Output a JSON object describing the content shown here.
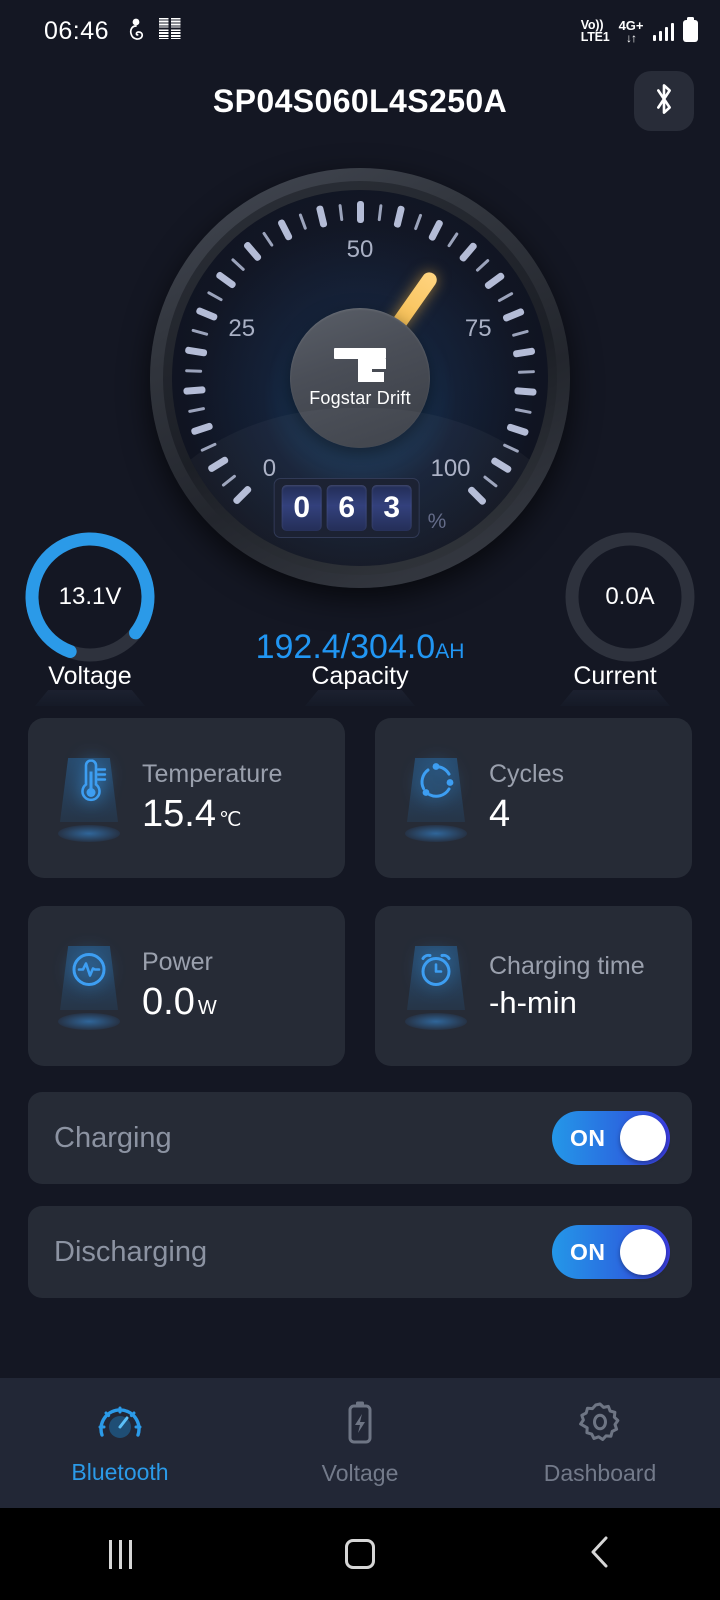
{
  "status_bar": {
    "clock": "06:46",
    "left_icons": [
      "notification-icon-1",
      "notification-icon-2"
    ],
    "volte_line1": "Vo))",
    "volte_line2": "LTE1",
    "network": "4G+",
    "data_arrows": "↓↑",
    "signal_icon": "signal-bars-icon",
    "battery_icon": "battery-full-icon"
  },
  "header": {
    "title": "SP04S060L4S250A",
    "bluetooth_icon": "bluetooth-icon"
  },
  "gauge": {
    "brand": "Fogstar Drift",
    "logo_icon": "fogstar-logo-icon",
    "tick_labels": [
      "0",
      "25",
      "50",
      "75",
      "100"
    ],
    "min": 0,
    "max": 100,
    "value": 63,
    "digits": [
      "0",
      "6",
      "3"
    ],
    "unit": "%"
  },
  "meters": {
    "voltage": {
      "value": "13.1V",
      "label": "Voltage",
      "percent": 80,
      "ring_color": "#2b9ae8"
    },
    "capacity": {
      "value": "192.4/304.0",
      "unit": "AH",
      "label": "Capacity",
      "color": "#2196f3"
    },
    "current": {
      "value": "0.0A",
      "label": "Current",
      "percent": 0,
      "ring_color": "#3a3f4c"
    }
  },
  "cards": [
    {
      "icon": "thermometer-icon",
      "title": "Temperature",
      "value": "15.4",
      "unit": "℃"
    },
    {
      "icon": "cycles-icon",
      "title": "Cycles",
      "value": "4",
      "unit": ""
    },
    {
      "icon": "power-pulse-icon",
      "title": "Power",
      "value": "0.0",
      "unit": "W"
    },
    {
      "icon": "alarm-clock-icon",
      "title": "Charging time",
      "value": "-h-min",
      "unit": ""
    }
  ],
  "toggles": [
    {
      "label": "Charging",
      "state": "ON"
    },
    {
      "label": "Discharging",
      "state": "ON"
    }
  ],
  "bottom_nav": [
    {
      "icon": "speedometer-icon",
      "label": "Bluetooth",
      "active": true
    },
    {
      "icon": "battery-bolt-icon",
      "label": "Voltage",
      "active": false
    },
    {
      "icon": "gear-icon",
      "label": "Dashboard",
      "active": false
    }
  ],
  "android_nav": {
    "recents_icon": "recents-icon",
    "home_icon": "home-icon",
    "back_icon": "back-icon"
  }
}
